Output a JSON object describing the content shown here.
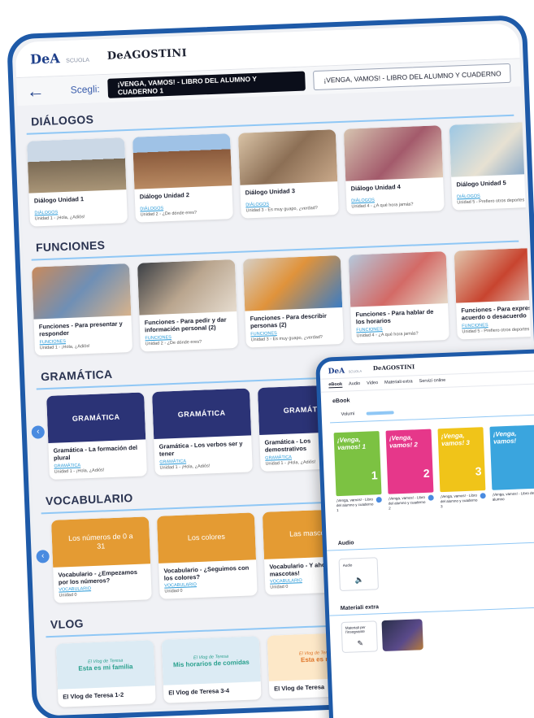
{
  "header": {
    "logo_dea": "DeA",
    "logo_scuola": "SCUOLA",
    "logo_deagostini": "DeAGOSTINI"
  },
  "selector": {
    "back_icon": "arrow-left-icon",
    "label": "Scegli:",
    "selected": "¡VENGA, VAMOS! - LIBRO DEL ALUMNO Y CUADERNO 1",
    "option2": "¡VENGA, VAMOS! - LIBRO DEL ALUMNO Y CUADERNO"
  },
  "dialogos": {
    "title": "DIÁLOGOS",
    "items": [
      {
        "title": "Diálogo Unidad 1",
        "tag": "DIÁLOGOS",
        "sub": "Unidad 1 - ¡Hola, ¿Adiós!"
      },
      {
        "title": "Diálogo Unidad 2",
        "tag": "DIÁLOGOS",
        "sub": "Unidad 2 - ¿De dónde eres?"
      },
      {
        "title": "Diálogo Unidad 3",
        "tag": "DIÁLOGOS",
        "sub": "Unidad 3 - Es muy guapo, ¿verdad?"
      },
      {
        "title": "Diálogo Unidad 4",
        "tag": "DIÁLOGOS",
        "sub": "Unidad 4 - ¿A qué hora jamás?"
      },
      {
        "title": "Diálogo Unidad 5",
        "tag": "DIÁLOGOS",
        "sub": "Unidad 5 - Prefiero otros deportes"
      }
    ]
  },
  "funciones": {
    "title": "FUNCIONES",
    "items": [
      {
        "title": "Funciones - Para presentar y responder",
        "tag": "FUNCIONES",
        "sub": "Unidad 1 - ¡Hola, ¿Adiós!"
      },
      {
        "title": "Funciones - Para pedir y dar información personal (2)",
        "tag": "FUNCIONES",
        "sub": "Unidad 2 - ¿De dónde eres?"
      },
      {
        "title": "Funciones - Para describir personas (2)",
        "tag": "FUNCIONES",
        "sub": "Unidad 3 - Es muy guapo, ¿verdad?"
      },
      {
        "title": "Funciones - Para hablar de los horarios",
        "tag": "FUNCIONES",
        "sub": "Unidad 4 - ¿A qué hora jamás?"
      },
      {
        "title": "Funciones - Para expresar acuerdo o desacuerdo",
        "tag": "FUNCIONES",
        "sub": "Unidad 5 - Prefiero otros deportes"
      }
    ]
  },
  "gramatica": {
    "title": "GRAMÁTICA",
    "items": [
      {
        "thumb": "GRAMÁTICA",
        "title": "Gramática - La formación del plural",
        "tag": "GRAMÁTICA",
        "sub": "Unidad 1 - ¡Hola, ¿Adiós!"
      },
      {
        "thumb": "GRAMÁTICA",
        "title": "Gramática - Los verbos ser y tener",
        "tag": "GRAMÁTICA",
        "sub": "Unidad 1 - ¡Hola, ¿Adiós!"
      },
      {
        "thumb": "GRAMÁTICA",
        "title": "Gramática - Los demostrativos",
        "tag": "GRAMÁTICA",
        "sub": "Unidad 1 - ¡Hola, ¿Adiós!"
      }
    ]
  },
  "vocabulario": {
    "title": "VOCABULARIO",
    "items": [
      {
        "thumb": "Los números de 0 a 31",
        "title": "Vocabulario - ¿Empezamos por los números?",
        "tag": "VOCABULARIO",
        "sub": "Unidad 0"
      },
      {
        "thumb": "Los colores",
        "title": "Vocabulario - ¿Seguimos con los colores?",
        "tag": "VOCABULARIO",
        "sub": "Unidad 0"
      },
      {
        "thumb": "Las mascotas",
        "title": "Vocabulario - Y ahora mascotas!",
        "tag": "VOCABULARIO",
        "sub": "Unidad 0"
      }
    ]
  },
  "vlog": {
    "title": "VLOG",
    "items": [
      {
        "small": "El Vlog de Teresa",
        "big": "Esta es mi familia",
        "title": "El Vlog de Teresa 1-2"
      },
      {
        "small": "El Vlog de Teresa",
        "big": "Mis horarios de comidas",
        "title": "El Vlog de Teresa 3-4"
      },
      {
        "small": "El Vlog de Teresa",
        "big": "Esta es mi",
        "title": "El Vlog de Teresa"
      }
    ]
  },
  "overlay": {
    "logo_dea": "DeA",
    "logo_scuola": "SCUOLA",
    "logo_deagostini": "DeAGOSTINI",
    "menu": [
      "eBook",
      "Audio",
      "Video",
      "Materiali extra",
      "Servizi online"
    ],
    "ebook_heading": "eBook",
    "volumi_label": "Volumi",
    "books": [
      {
        "title": "¡Venga, vamos! 1",
        "number": "1",
        "caption": "¡Venga, vamos! - Libro del alumno y cuaderno 1",
        "color": "#7cc242"
      },
      {
        "title": "¡Venga, vamos! 2",
        "number": "2",
        "caption": "¡Venga, vamos! - Libro del alumno y cuaderno 2",
        "color": "#e6378a"
      },
      {
        "title": "¡Venga, vamos! 3",
        "number": "3",
        "caption": "¡Venga, vamos! - Libro del alumno y cuaderno 3",
        "color": "#f0c419"
      },
      {
        "title": "¡Venga, vamos!",
        "number": "",
        "caption": "¡Venga, vamos! - Libro del alumno",
        "color": "#3aa5de"
      }
    ],
    "audio_heading": "Audio",
    "audio_card_label": "Audio",
    "extra_heading": "Materiali extra",
    "extra_card_label": "Materiali per l'insegnante"
  }
}
